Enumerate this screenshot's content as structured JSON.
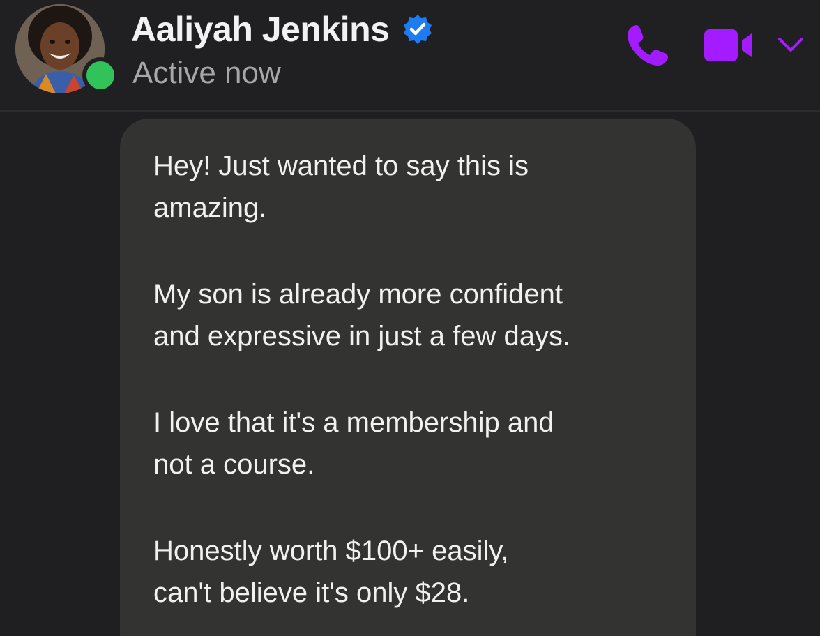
{
  "contact": {
    "name": "Aaliyah Jenkins",
    "status": "Active now",
    "verified": true,
    "online": true
  },
  "header_actions": {
    "call_icon": "phone-icon",
    "video_icon": "video-camera-icon",
    "menu_icon": "chevron-down-icon"
  },
  "colors": {
    "accent": "#a21cff",
    "presence": "#31c35a",
    "verified_badge": "#1d7cf2",
    "bubble": "#333331",
    "background": "#1f1f21"
  },
  "message": {
    "paragraphs": [
      "Hey! Just wanted to say this is\namazing.",
      "My son is already more confident\nand expressive in just a few days.",
      "I love that it's a membership and\nnot a course.",
      "Honestly worth $100+ easily,\ncan't believe it's only $28."
    ]
  }
}
